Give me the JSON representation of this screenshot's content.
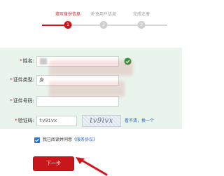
{
  "steps": [
    {
      "label": "填写身份信息",
      "number": "1",
      "state": "active"
    },
    {
      "label": "补充用户信息",
      "number": "2",
      "state": "pending"
    },
    {
      "label": "完成注册",
      "number": "3",
      "state": "pending"
    }
  ],
  "form": {
    "name": {
      "label": "姓名:",
      "required": "*",
      "value": ""
    },
    "id_type": {
      "label": "证件类型:",
      "required": "*",
      "value": "身"
    },
    "id_number": {
      "label": "证件号码:",
      "required": "*",
      "value": ""
    },
    "captcha": {
      "label": "验证码:",
      "required": "*",
      "value": "tv9ivx",
      "image_text": "tv9ivx",
      "refresh_text": "看不清，换一个"
    }
  },
  "agreement": {
    "checked": true,
    "text": "我已阅读并同意",
    "link_text": "《服务协议》"
  },
  "next_button": {
    "label": "下一步"
  },
  "colors": {
    "accent": "#c8161d",
    "panel_bg": "#e9f4ec",
    "link": "#2b64b8",
    "success": "#2a9d3f"
  },
  "icons": {
    "name_valid": "check-circle-icon",
    "annotation": "red-arrow-icon"
  }
}
